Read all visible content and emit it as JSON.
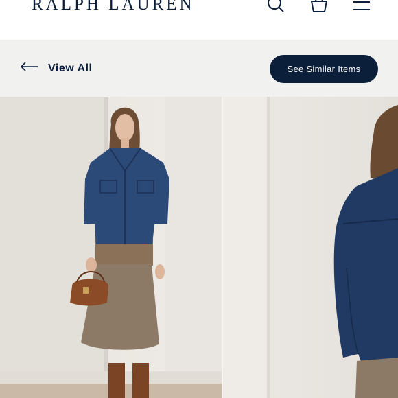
{
  "header": {
    "brand": "RALPH LAUREN",
    "icons": [
      "search-icon",
      "shopping-bag-icon",
      "menu-icon"
    ]
  },
  "subnav": {
    "back_label": "View All",
    "back_icon": "arrow-left-icon",
    "similar_label": "See Similar Items"
  },
  "colors": {
    "brand_navy": "#0b1f3a",
    "subbar_bg": "#f1f1f0"
  },
  "gallery": {
    "images": [
      "model-front-photo",
      "model-back-photo"
    ]
  }
}
